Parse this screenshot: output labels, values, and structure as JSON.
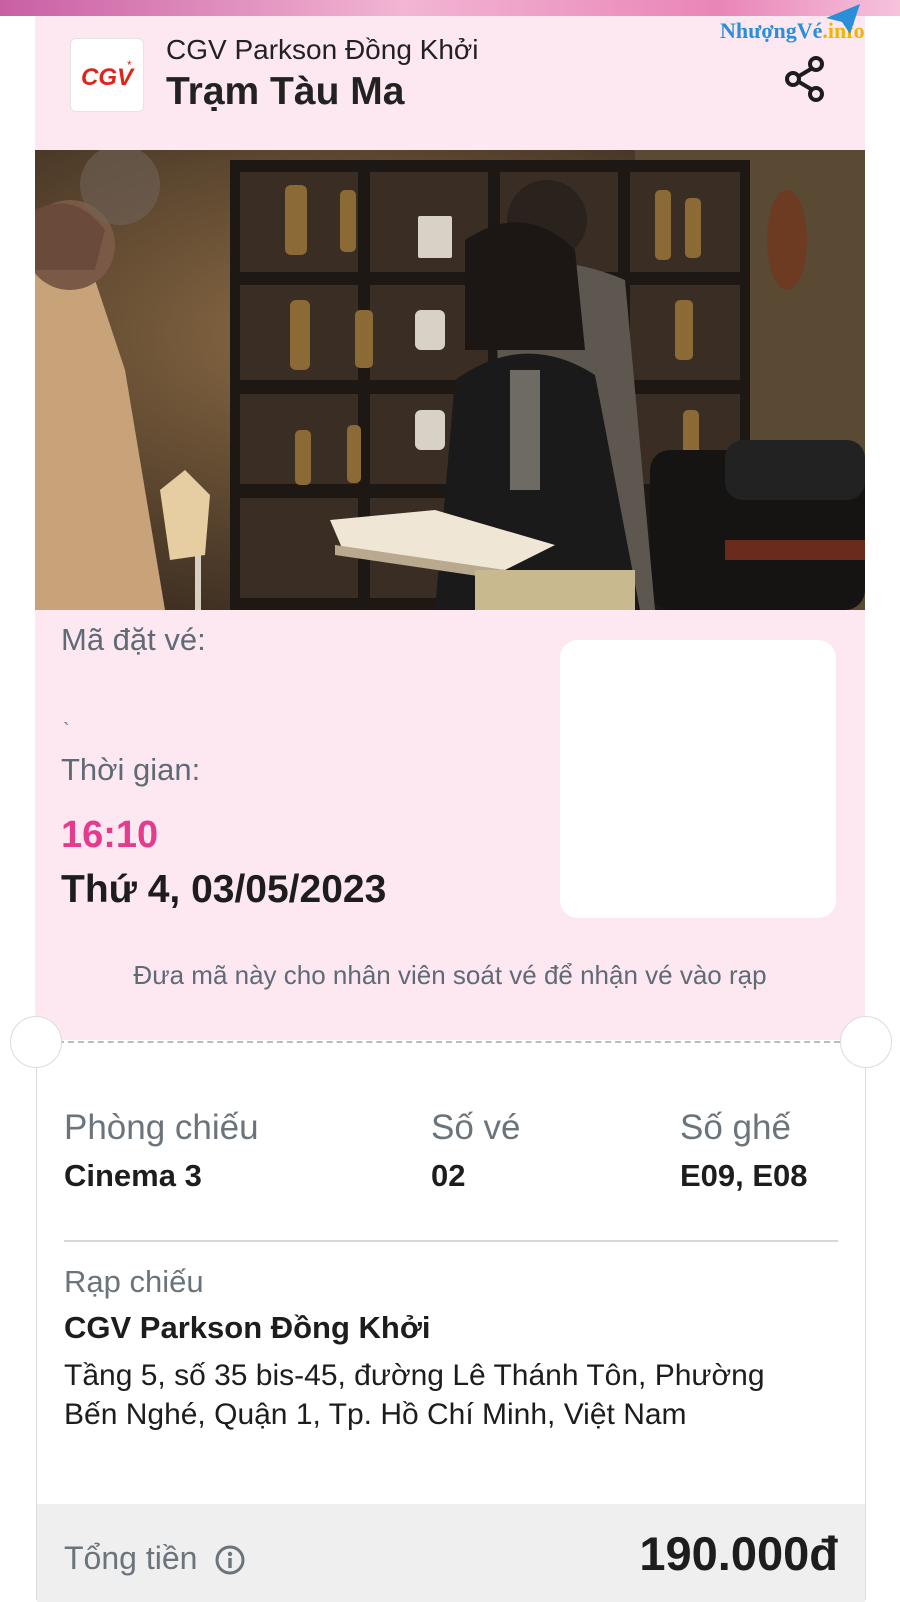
{
  "watermark": {
    "part1": "NhượngVé",
    "part2": ".info"
  },
  "header": {
    "logo_text": "CGV",
    "cinema": "CGV Parkson Đồng Khởi",
    "movie_title": "Trạm Tàu Ma"
  },
  "booking": {
    "code_label": "Mã đặt vé:",
    "code_value": "`",
    "time_label": "Thời gian:",
    "time": "16:10",
    "date": "Thứ 4, 03/05/2023",
    "instruction": "Đưa mã này cho nhân viên soát vé để nhận vé vào rạp"
  },
  "details": {
    "room_label": "Phòng chiếu",
    "room_value": "Cinema 3",
    "tickets_label": "Số vé",
    "tickets_value": "02",
    "seats_label": "Số ghế",
    "seats_value": "E09, E08",
    "theater_label": "Rạp chiếu",
    "theater_name": "CGV Parkson Đồng Khởi",
    "address": "Tầng 5, số 35 bis-45, đường Lê Thánh Tôn, Phường Bến Nghé, Quận 1, Tp. Hồ Chí Minh, Việt Nam"
  },
  "total": {
    "label": "Tổng tiền",
    "value": "190.000đ"
  },
  "colors": {
    "accent": "#e53b8d",
    "card_bg": "#fde8f2",
    "cgv_red": "#e2231a"
  },
  "icons": [
    "cgv-logo-icon",
    "share-icon",
    "info-icon",
    "paper-plane-icon"
  ]
}
